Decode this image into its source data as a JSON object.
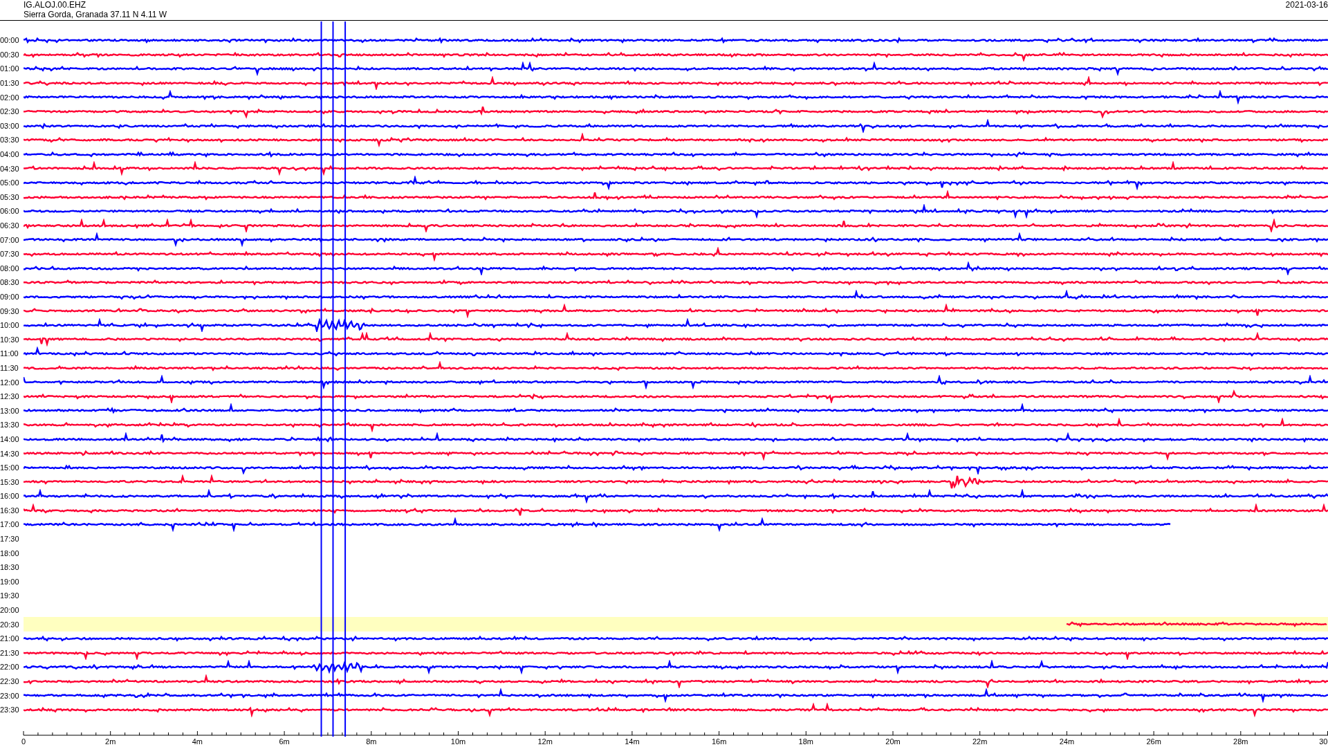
{
  "header": {
    "station": "IG.ALOJ.00.EHZ",
    "location": "Sierra Gorda, Granada  37.11 N 4.11 W",
    "date": "2021-03-16"
  },
  "rows": [
    {
      "label": "00:00",
      "color": "#0000ff",
      "highlighted": false,
      "kind": "full"
    },
    {
      "label": "00:30",
      "color": "#ff0033",
      "highlighted": false,
      "kind": "full"
    },
    {
      "label": "01:00",
      "color": "#0000ff",
      "highlighted": false,
      "kind": "full"
    },
    {
      "label": "01:30",
      "color": "#ff0033",
      "highlighted": false,
      "kind": "full"
    },
    {
      "label": "02:00",
      "color": "#0000ff",
      "highlighted": false,
      "kind": "full"
    },
    {
      "label": "02:30",
      "color": "#ff0033",
      "highlighted": false,
      "kind": "full"
    },
    {
      "label": "03:00",
      "color": "#0000ff",
      "highlighted": false,
      "kind": "full"
    },
    {
      "label": "03:30",
      "color": "#ff0033",
      "highlighted": false,
      "kind": "full"
    },
    {
      "label": "04:00",
      "color": "#0000ff",
      "highlighted": false,
      "kind": "full"
    },
    {
      "label": "04:30",
      "color": "#ff0033",
      "highlighted": false,
      "kind": "full"
    },
    {
      "label": "05:00",
      "color": "#0000ff",
      "highlighted": false,
      "kind": "full"
    },
    {
      "label": "05:30",
      "color": "#ff0033",
      "highlighted": false,
      "kind": "full"
    },
    {
      "label": "06:00",
      "color": "#0000ff",
      "highlighted": false,
      "kind": "full"
    },
    {
      "label": "06:30",
      "color": "#ff0033",
      "highlighted": false,
      "kind": "full"
    },
    {
      "label": "07:00",
      "color": "#0000ff",
      "highlighted": false,
      "kind": "full"
    },
    {
      "label": "07:30",
      "color": "#ff0033",
      "highlighted": false,
      "kind": "full"
    },
    {
      "label": "08:00",
      "color": "#0000ff",
      "highlighted": false,
      "kind": "full"
    },
    {
      "label": "08:30",
      "color": "#ff0033",
      "highlighted": false,
      "kind": "full"
    },
    {
      "label": "09:00",
      "color": "#0000ff",
      "highlighted": false,
      "kind": "full"
    },
    {
      "label": "09:30",
      "color": "#ff0033",
      "highlighted": false,
      "kind": "full"
    },
    {
      "label": "10:00",
      "color": "#0000ff",
      "highlighted": false,
      "kind": "full"
    },
    {
      "label": "10:30",
      "color": "#ff0033",
      "highlighted": false,
      "kind": "full"
    },
    {
      "label": "11:00",
      "color": "#0000ff",
      "highlighted": false,
      "kind": "full"
    },
    {
      "label": "11:30",
      "color": "#ff0033",
      "highlighted": false,
      "kind": "full"
    },
    {
      "label": "12:00",
      "color": "#0000ff",
      "highlighted": false,
      "kind": "full"
    },
    {
      "label": "12:30",
      "color": "#ff0033",
      "highlighted": false,
      "kind": "full"
    },
    {
      "label": "13:00",
      "color": "#0000ff",
      "highlighted": false,
      "kind": "full"
    },
    {
      "label": "13:30",
      "color": "#ff0033",
      "highlighted": false,
      "kind": "full"
    },
    {
      "label": "14:00",
      "color": "#0000ff",
      "highlighted": false,
      "kind": "full"
    },
    {
      "label": "14:30",
      "color": "#ff0033",
      "highlighted": false,
      "kind": "full"
    },
    {
      "label": "15:00",
      "color": "#0000ff",
      "highlighted": false,
      "kind": "full"
    },
    {
      "label": "15:30",
      "color": "#ff0033",
      "highlighted": false,
      "kind": "full"
    },
    {
      "label": "16:00",
      "color": "#0000ff",
      "highlighted": false,
      "kind": "full"
    },
    {
      "label": "16:30",
      "color": "#ff0033",
      "highlighted": false,
      "kind": "full"
    },
    {
      "label": "17:00",
      "color": "#0000ff",
      "highlighted": false,
      "kind": "ends_early"
    },
    {
      "label": "17:30",
      "highlighted": false,
      "kind": "none"
    },
    {
      "label": "18:00",
      "highlighted": false,
      "kind": "none"
    },
    {
      "label": "18:30",
      "highlighted": false,
      "kind": "none"
    },
    {
      "label": "19:00",
      "highlighted": false,
      "kind": "none"
    },
    {
      "label": "19:30",
      "highlighted": false,
      "kind": "none"
    },
    {
      "label": "20:00",
      "highlighted": false,
      "kind": "none"
    },
    {
      "label": "20:30",
      "color": "#ff0033",
      "highlighted": true,
      "kind": "starts_late"
    },
    {
      "label": "21:00",
      "color": "#0000ff",
      "highlighted": false,
      "kind": "full"
    },
    {
      "label": "21:30",
      "color": "#ff0033",
      "highlighted": false,
      "kind": "full"
    },
    {
      "label": "22:00",
      "color": "#0000ff",
      "highlighted": false,
      "kind": "full"
    },
    {
      "label": "22:30",
      "color": "#ff0033",
      "highlighted": false,
      "kind": "full"
    },
    {
      "label": "23:00",
      "color": "#0000ff",
      "highlighted": false,
      "kind": "full"
    },
    {
      "label": "23:30",
      "color": "#ff0033",
      "highlighted": false,
      "kind": "full"
    }
  ],
  "axis": {
    "tick_labels": [
      "0",
      "2m",
      "4m",
      "6m",
      "8m",
      "10m",
      "12m",
      "14m",
      "16m",
      "18m",
      "20m",
      "22m",
      "24m",
      "26m",
      "28m",
      "30"
    ]
  }
}
